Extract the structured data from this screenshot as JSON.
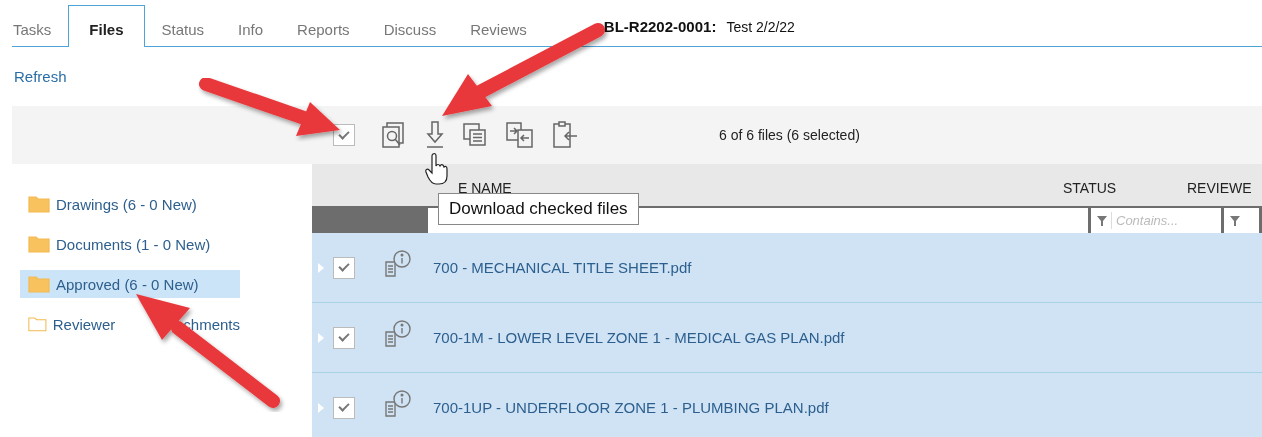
{
  "tabs": [
    {
      "label": "Tasks",
      "selected": false
    },
    {
      "label": "Files",
      "selected": true
    },
    {
      "label": "Status",
      "selected": false
    },
    {
      "label": "Info",
      "selected": false
    },
    {
      "label": "Reports",
      "selected": false
    },
    {
      "label": "Discuss",
      "selected": false
    },
    {
      "label": "Reviews",
      "selected": false
    }
  ],
  "record": {
    "id": "BL-R2202-0001:",
    "name": "Test 2/2/22"
  },
  "refresh": "Refresh",
  "toolbar": {
    "select_all_checked": true,
    "counter": "6 of 6 files (6 selected)"
  },
  "folders": [
    {
      "label": "Drawings (6 - 0 New)",
      "selected": false,
      "empty": false
    },
    {
      "label": "Documents (1 - 0 New)",
      "selected": false,
      "empty": false
    },
    {
      "label": "Approved (6 - 0 New)",
      "selected": true,
      "empty": false
    },
    {
      "label": "Reviewer",
      "label_end": "chments",
      "selected": false,
      "empty": true
    }
  ],
  "table": {
    "columns": [
      "E NAME",
      "STATUS",
      "REVIEWE"
    ],
    "status_filter": {
      "placeholder": "Contains..."
    },
    "rows": [
      {
        "name": "700 - MECHANICAL TITLE SHEET.pdf",
        "checked": true
      },
      {
        "name": "700-1M - LOWER LEVEL ZONE 1 - MEDICAL GAS PLAN.pdf",
        "checked": true
      },
      {
        "name": "700-1UP - UNDERFLOOR ZONE 1 - PLUMBING PLAN.pdf",
        "checked": true
      }
    ]
  },
  "tooltip": "Download checked files"
}
